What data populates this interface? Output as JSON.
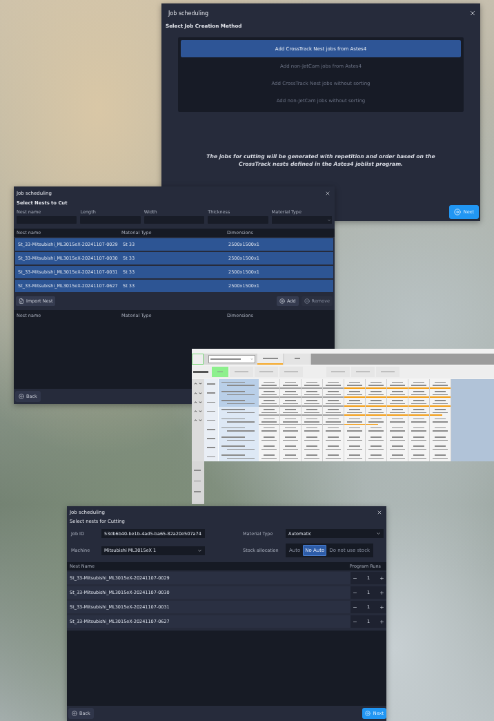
{
  "creation_window": {
    "title": "Job scheduling",
    "subtitle": "Select Job Creation Method",
    "options": [
      {
        "label": "Add CrossTrack Nest jobs from Astes4",
        "selected": true
      },
      {
        "label": "Add non-JetCam jobs from Astes4",
        "selected": false
      },
      {
        "label": "Add CrossTrack Nest jobs without sorting",
        "selected": false
      },
      {
        "label": "Add non-JetCam jobs without sorting",
        "selected": false
      }
    ],
    "description": "The jobs for cutting will be generated with repetition and order based on the CrossTrack nests defined in the Astes4 joblist program.",
    "next_button": "Next"
  },
  "nests_window": {
    "title": "Job scheduling",
    "subtitle": "Select Nests to Cut",
    "filters": [
      {
        "label": "Nest name",
        "kind": "text"
      },
      {
        "label": "Length",
        "kind": "text"
      },
      {
        "label": "Width",
        "kind": "text"
      },
      {
        "label": "Thickness",
        "kind": "text"
      },
      {
        "label": "Material Type",
        "kind": "select"
      }
    ],
    "available_columns": [
      "Nest name",
      "Material Type",
      "Dimensions"
    ],
    "available_rows": [
      {
        "name": "St_33-Mitsubishi_ML3015eX-20241107-0029",
        "material": "St 33",
        "dimensions": "2500x1500x1",
        "selected": true
      },
      {
        "name": "St_33-Mitsubishi_ML3015eX-20241107-0030",
        "material": "St 33",
        "dimensions": "2500x1500x1",
        "selected": true
      },
      {
        "name": "St_33-Mitsubishi_ML3015eX-20241107-0031",
        "material": "St 33",
        "dimensions": "2500x1500x1",
        "selected": true
      },
      {
        "name": "St_33-Mitsubishi_ML3015eX-20241107-0627",
        "material": "St 33",
        "dimensions": "2500x1500x1",
        "selected": true
      }
    ],
    "import_button": "Import Nest",
    "add_button": "Add",
    "remove_button": {
      "label": "Remove",
      "disabled": true
    },
    "chosen_columns": [
      "Nest name",
      "Material Type",
      "Dimensions"
    ],
    "back_button": "Back"
  },
  "cell_window": {
    "tabs": [
      {
        "selected": true
      },
      {
        "selected": false
      }
    ],
    "actions": [
      {
        "kind": "primary"
      },
      {
        "kind": "plain"
      },
      {
        "kind": "plain"
      },
      {
        "kind": "plain"
      },
      {
        "kind": "gap"
      },
      {
        "kind": "plain"
      },
      {
        "kind": "plain"
      },
      {
        "kind": "plain"
      }
    ],
    "rows": [
      {
        "movable": true,
        "highlighted": true,
        "stages": [
          {
            "kind": "stopped"
          },
          {
            "kind": "stopped"
          },
          {
            "kind": "stopped"
          },
          {
            "kind": "stopped"
          },
          {
            "kind": "completed"
          },
          {
            "kind": "completed"
          },
          {
            "kind": "completed"
          },
          {
            "kind": "completed"
          },
          {
            "kind": "completed"
          }
        ]
      },
      {
        "movable": true,
        "highlighted": true,
        "stages": [
          {
            "kind": "stopped"
          },
          {
            "kind": "stopped"
          },
          {
            "kind": "stopped"
          },
          {
            "kind": "stopped"
          },
          {
            "kind": "completed"
          },
          {
            "kind": "completed"
          },
          {
            "kind": "completed"
          },
          {
            "kind": "completed"
          },
          {
            "kind": "completed"
          }
        ]
      },
      {
        "movable": true,
        "highlighted": true,
        "stages": [
          {
            "kind": "stopped"
          },
          {
            "kind": "stopped"
          },
          {
            "kind": "stopped"
          },
          {
            "kind": "stopped"
          },
          {
            "kind": "completed"
          },
          {
            "kind": "completed"
          },
          {
            "kind": "completed"
          },
          {
            "kind": "completed"
          },
          {
            "kind": "completed"
          }
        ]
      },
      {
        "movable": true,
        "highlighted": false,
        "stages": [
          {
            "kind": "stopped"
          },
          {
            "kind": "stopped"
          },
          {
            "kind": "stopped"
          },
          {
            "kind": "stopped"
          },
          {
            "kind": "completed"
          },
          {
            "kind": "completed"
          },
          {
            "kind": "completed"
          },
          {
            "kind": "completed"
          },
          {
            "kind": "in_progress"
          }
        ]
      },
      {
        "movable": true,
        "highlighted": false,
        "stages": [
          {
            "kind": "stopped"
          },
          {
            "kind": "stopped"
          },
          {
            "kind": "stopped"
          },
          {
            "kind": "stopped"
          },
          {
            "kind": "completed"
          },
          {
            "kind": "in_progress"
          },
          {
            "kind": "not_started"
          },
          {
            "kind": "not_started"
          },
          {
            "kind": "not_started"
          }
        ]
      },
      {
        "movable": false,
        "highlighted": false,
        "stages": [
          {
            "kind": "not_started"
          },
          {
            "kind": "not_started"
          },
          {
            "kind": "not_started"
          },
          {
            "kind": "not_started"
          },
          {
            "kind": "not_started"
          },
          {
            "kind": "not_started"
          },
          {
            "kind": "not_started"
          },
          {
            "kind": "not_started"
          },
          {
            "kind": "not_started"
          }
        ]
      },
      {
        "movable": false,
        "highlighted": false,
        "stages": [
          {
            "kind": "not_started"
          },
          {
            "kind": "not_started"
          },
          {
            "kind": "not_started"
          },
          {
            "kind": "not_started"
          },
          {
            "kind": "not_started"
          },
          {
            "kind": "not_started"
          },
          {
            "kind": "not_started"
          },
          {
            "kind": "not_started"
          },
          {
            "kind": "not_started"
          }
        ]
      },
      {
        "movable": false,
        "highlighted": false,
        "stages": [
          {
            "kind": "not_started"
          },
          {
            "kind": "not_started"
          },
          {
            "kind": "not_started"
          },
          {
            "kind": "not_started"
          },
          {
            "kind": "not_started"
          },
          {
            "kind": "not_started"
          },
          {
            "kind": "not_started"
          },
          {
            "kind": "not_started"
          },
          {
            "kind": "not_started"
          }
        ]
      },
      {
        "movable": false,
        "highlighted": false,
        "stages": [
          {
            "kind": "not_started"
          },
          {
            "kind": "not_started"
          },
          {
            "kind": "not_started"
          },
          {
            "kind": "not_started"
          },
          {
            "kind": "not_started"
          },
          {
            "kind": "not_started"
          },
          {
            "kind": "not_started"
          },
          {
            "kind": "not_started"
          },
          {
            "kind": "not_started"
          }
        ]
      }
    ]
  },
  "cutting_window": {
    "title": "Job scheduling",
    "subtitle": "Select nests for Cutting",
    "job_id_label": "Job ID",
    "job_id": "53db6b40-be1b-4ad5-ba65-82a20e507a74",
    "machine_label": "Machine",
    "machine": "Mitsubishi ML3015eX 1",
    "material_label": "Material Type",
    "material": "Automatic",
    "stock_label": "Stock allocation",
    "stock_options": [
      {
        "label": "Auto",
        "selected": false
      },
      {
        "label": "No Auto",
        "selected": true
      },
      {
        "label": "Do not use stock",
        "selected": false
      }
    ],
    "columns": [
      "Nest Name",
      "Program Runs"
    ],
    "rows": [
      {
        "name": "St_33-Mitsubishi_ML3015eX-20241107-0029",
        "runs": "1"
      },
      {
        "name": "St_33-Mitsubishi_ML3015eX-20241107-0030",
        "runs": "1"
      },
      {
        "name": "St_33-Mitsubishi_ML3015eX-20241107-0031",
        "runs": "1"
      },
      {
        "name": "St_33-Mitsubishi_ML3015eX-20241107-0627",
        "runs": "1"
      }
    ],
    "back_button": "Back",
    "next_button": "Next"
  }
}
